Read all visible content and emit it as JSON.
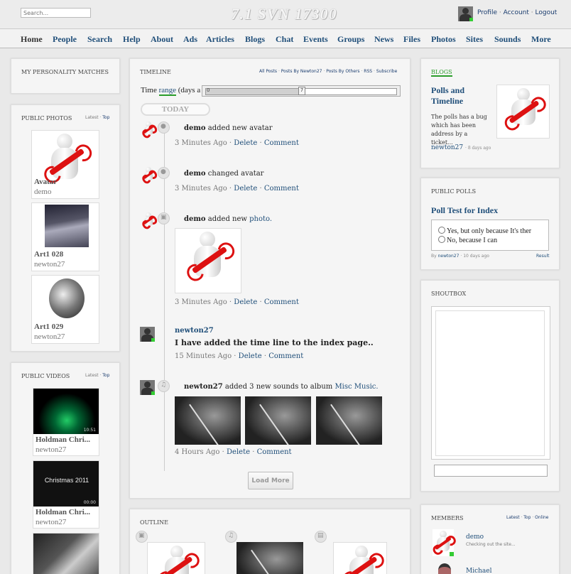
{
  "header": {
    "search_placeholder": "Search...",
    "site_title": "7.1 SVN 17300",
    "user_links": [
      "Profile",
      "Account",
      "Logout"
    ]
  },
  "nav": [
    "Home",
    "People",
    "Search",
    "Help",
    "About",
    "Ads",
    "Articles",
    "Blogs",
    "Chat",
    "Events",
    "Groups",
    "News",
    "Files",
    "Photos",
    "Sites",
    "Sounds",
    "More"
  ],
  "left": {
    "matches_title": "MY PERSONALITY MATCHES",
    "photos": {
      "title": "PUBLIC PHOTOS",
      "links": [
        "Latest",
        "Top"
      ],
      "items": [
        {
          "title": "Avatar",
          "user": "demo"
        },
        {
          "title": "Art1 028",
          "user": "newton27"
        },
        {
          "title": "Art1 029",
          "user": "newton27"
        }
      ]
    },
    "videos": {
      "title": "PUBLIC VIDEOS",
      "links": [
        "Latest",
        "Top"
      ],
      "items": [
        {
          "title": "Holdman Chri...",
          "user": "newton27",
          "duration": "10:51"
        },
        {
          "title": "Holdman Chri...",
          "user": "newton27",
          "duration": "00:00",
          "overlay": "Christmas 2011"
        },
        {
          "title": "",
          "user": "",
          "duration": ""
        }
      ]
    }
  },
  "timeline": {
    "title": "TIMELINE",
    "links": [
      "All Posts",
      "Posts By Newton27",
      "Posts By Others",
      "RSS",
      "Subscribe"
    ],
    "range_label_pre": "Time ",
    "range_link": "range",
    "range_label_post": " (days a",
    "slider_min": "0",
    "slider_max": "7",
    "today": "TODAY",
    "entries": [
      {
        "user": "demo",
        "text": " added new avatar",
        "link": "",
        "time": "3 Minutes Ago"
      },
      {
        "user": "demo",
        "text": " changed avatar",
        "link": "",
        "time": "3 Minutes Ago"
      },
      {
        "user": "demo",
        "text": " added new ",
        "link": "photo.",
        "time": "3 Minutes Ago"
      },
      {
        "user": "newton27",
        "text": "I have added the time line to the index page..",
        "link": "",
        "time": "15 Minutes Ago"
      },
      {
        "user": "newton27",
        "text": " added 3 new sounds to album ",
        "link": "Misc Music.",
        "time": "4 Hours Ago"
      }
    ],
    "actions": [
      "Delete",
      "Comment"
    ],
    "load_more": "Load More"
  },
  "outline": {
    "title": "OUTLINE"
  },
  "right": {
    "blogs": {
      "title": "BLOGS",
      "post_title": "Polls and Timeline",
      "excerpt": "The polls has a bug which has been address by a ticket...",
      "author": "newton27",
      "age": "8 days ago"
    },
    "polls": {
      "title": "PUBLIC POLLS",
      "poll_title": "Poll Test for Index",
      "options": [
        "Yes, but only because It's ther",
        "No, because I can"
      ],
      "byline_pre": "By ",
      "author": "newton27",
      "age": "10 days ago",
      "results": "Result"
    },
    "shoutbox": {
      "title": "SHOUTBOX"
    },
    "members": {
      "title": "MEMBERS",
      "links": [
        "Latest",
        "Top",
        "Online"
      ],
      "items": [
        {
          "name": "demo",
          "status": "Checking out the site..."
        },
        {
          "name": "Michael",
          "status": ""
        }
      ]
    }
  },
  "colors": {
    "link": "#1f4e79",
    "accent_green": "#2a9d2a",
    "wrench_red": "#d11111"
  }
}
